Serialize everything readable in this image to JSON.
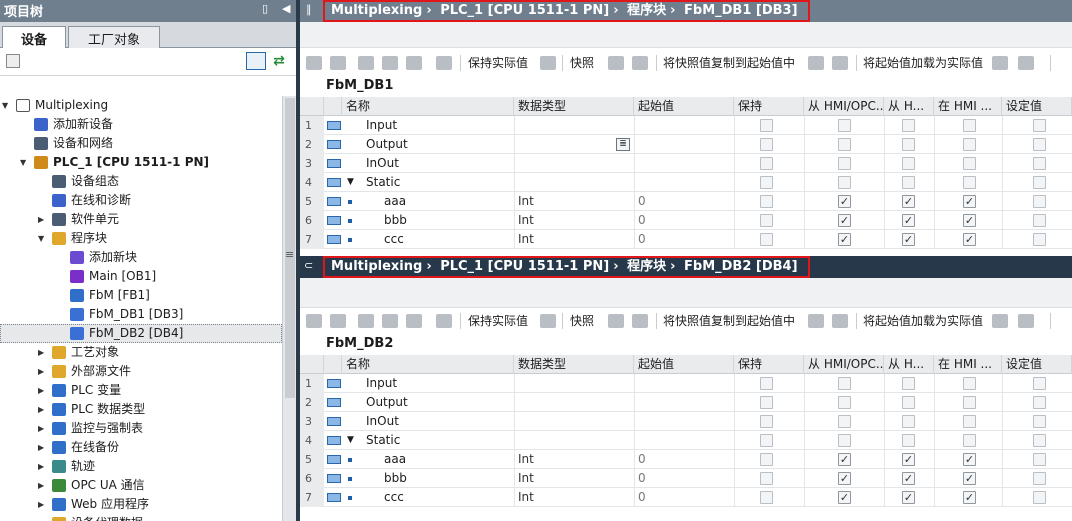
{
  "project_tree": {
    "title": "项目树",
    "tab_devices": "设备",
    "tab_factory": "工厂对象",
    "items": [
      {
        "label": "Multiplexing",
        "indent": 0,
        "expanded": true,
        "icon": "project-icon"
      },
      {
        "label": "添加新设备",
        "indent": 1,
        "icon": "add-device-icon"
      },
      {
        "label": "设备和网络",
        "indent": 1,
        "icon": "network-icon"
      },
      {
        "label": "PLC_1 [CPU 1511-1 PN]",
        "indent": 1,
        "expanded": true,
        "icon": "plc-icon",
        "bold": true
      },
      {
        "label": "设备组态",
        "indent": 2,
        "icon": "device-config-icon"
      },
      {
        "label": "在线和诊断",
        "indent": 2,
        "icon": "diagnostics-icon"
      },
      {
        "label": "软件单元",
        "indent": 2,
        "collapsed": true,
        "icon": "software-unit-icon"
      },
      {
        "label": "程序块",
        "indent": 2,
        "expanded": true,
        "icon": "folder-icon"
      },
      {
        "label": "添加新块",
        "indent": 3,
        "icon": "add-block-icon"
      },
      {
        "label": "Main [OB1]",
        "indent": 3,
        "icon": "ob-icon"
      },
      {
        "label": "FbM [FB1]",
        "indent": 3,
        "icon": "fb-icon"
      },
      {
        "label": "FbM_DB1 [DB3]",
        "indent": 3,
        "icon": "db-icon"
      },
      {
        "label": "FbM_DB2 [DB4]",
        "indent": 3,
        "icon": "db-icon",
        "selected": true
      },
      {
        "label": "工艺对象",
        "indent": 2,
        "collapsed": true,
        "icon": "folder-icon"
      },
      {
        "label": "外部源文件",
        "indent": 2,
        "collapsed": true,
        "icon": "folder-icon"
      },
      {
        "label": "PLC 变量",
        "indent": 2,
        "collapsed": true,
        "icon": "tag-icon"
      },
      {
        "label": "PLC 数据类型",
        "indent": 2,
        "collapsed": true,
        "icon": "datatype-icon"
      },
      {
        "label": "监控与强制表",
        "indent": 2,
        "collapsed": true,
        "icon": "watch-table-icon"
      },
      {
        "label": "在线备份",
        "indent": 2,
        "collapsed": true,
        "icon": "backup-icon"
      },
      {
        "label": "轨迹",
        "indent": 2,
        "collapsed": true,
        "icon": "trace-icon"
      },
      {
        "label": "OPC UA 通信",
        "indent": 2,
        "collapsed": true,
        "icon": "opcua-icon"
      },
      {
        "label": "Web 应用程序",
        "indent": 2,
        "collapsed": true,
        "icon": "web-icon"
      },
      {
        "label": "设备代理数据",
        "indent": 2,
        "collapsed": true,
        "icon": "folder-icon"
      }
    ]
  },
  "editor1": {
    "breadcrumb": [
      "Multiplexing",
      "PLC_1 [CPU 1511-1 PN]",
      "程序块",
      "FbM_DB1 [DB3]"
    ],
    "block_title": "FbM_DB1"
  },
  "editor2": {
    "breadcrumb": [
      "Multiplexing",
      "PLC_1 [CPU 1511-1 PN]",
      "程序块",
      "FbM_DB2 [DB4]"
    ],
    "block_title": "FbM_DB2"
  },
  "toolbar": {
    "keep_actual": "保持实际值",
    "snapshot": "快照",
    "copy_snapshot": "将快照值复制到起始值中",
    "load_start": "将起始值加载为实际值"
  },
  "columns": [
    "名称",
    "数据类型",
    "起始值",
    "保持",
    "从 HMI/OPC...",
    "从 H...",
    "在 HMI ...",
    "设定值"
  ],
  "rows": [
    {
      "num": "1",
      "name": "Input",
      "type": "",
      "start": "",
      "kind": "section"
    },
    {
      "num": "2",
      "name": "Output",
      "type": "",
      "start": "",
      "kind": "section"
    },
    {
      "num": "3",
      "name": "InOut",
      "type": "",
      "start": "",
      "kind": "section"
    },
    {
      "num": "4",
      "name": "Static",
      "type": "",
      "start": "",
      "kind": "static"
    },
    {
      "num": "5",
      "name": "aaa",
      "type": "Int",
      "start": "0",
      "kind": "var",
      "retain": false,
      "hmi1": true,
      "hmi2": true,
      "hmi3": true,
      "setpoint": false
    },
    {
      "num": "6",
      "name": "bbb",
      "type": "Int",
      "start": "0",
      "kind": "var",
      "retain": false,
      "hmi1": true,
      "hmi2": true,
      "hmi3": true,
      "setpoint": false
    },
    {
      "num": "7",
      "name": "ccc",
      "type": "Int",
      "start": "0",
      "kind": "var",
      "retain": false,
      "hmi1": true,
      "hmi2": true,
      "hmi3": true,
      "setpoint": false
    }
  ],
  "colors": {
    "header_bg": "#6f7f8e",
    "header_dark": "#26384a",
    "highlight_border": "#e0161b",
    "accent_blue": "#1e5ea8"
  }
}
